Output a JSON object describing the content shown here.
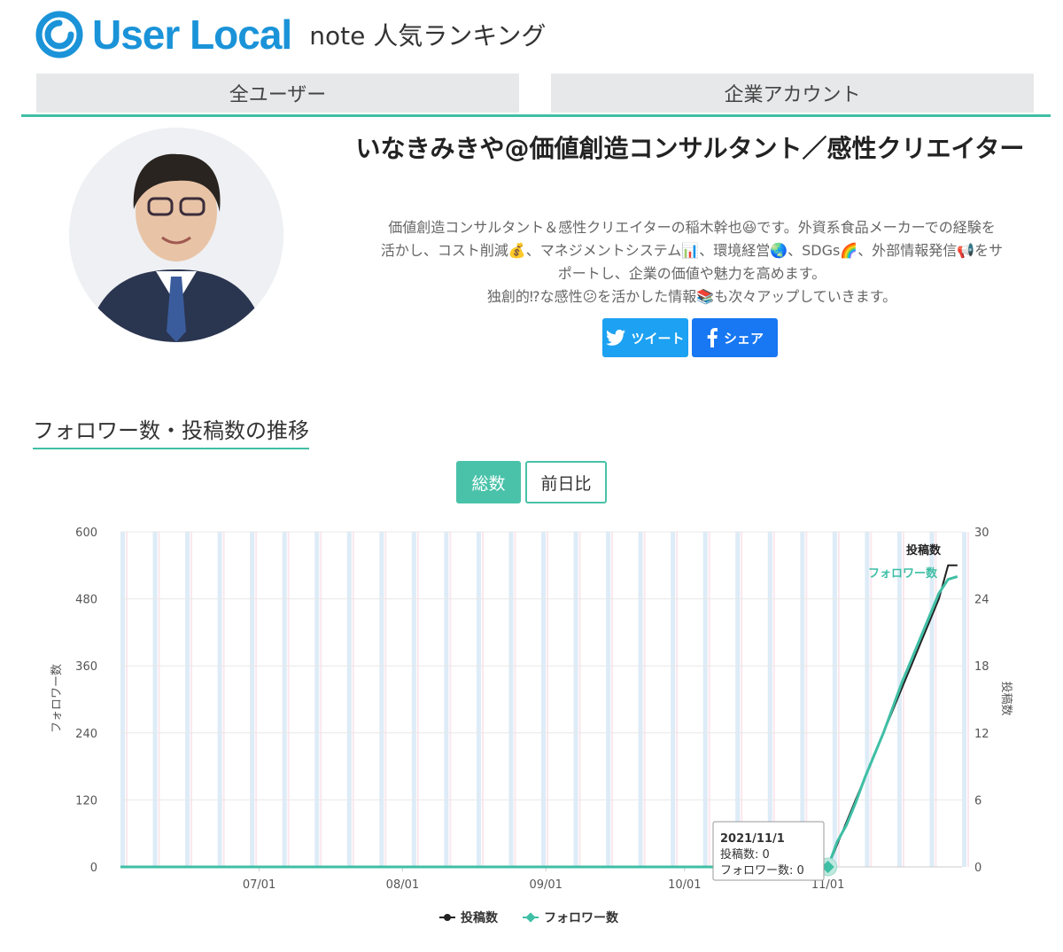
{
  "brand": {
    "name": "User Local",
    "site_title": "note 人気ランキング",
    "accent": "#1a93d8"
  },
  "tabs": [
    {
      "label": "全ユーザー"
    },
    {
      "label": "企業アカウント"
    }
  ],
  "profile": {
    "name": "いなきみきや@価値創造コンサルタント／感性クリエイター",
    "desc_lines": [
      "価値創造コンサルタント＆感性クリエイターの稲木幹也😆です。外資系食品メーカーでの経験を",
      "活かし、コスト削減💰、マネジメントシステム📊、環境経営🌏、SDGs🌈、外部情報発信📢をサ",
      "ポートし、企業の価値や魅力を高めます。",
      "独創的⁉な感性😕を活かした情報📚も次々アップしていきます。"
    ]
  },
  "share": {
    "tweet": "ツイート",
    "facebook": "シェア"
  },
  "section": {
    "title": "フォロワー数・投稿数の推移"
  },
  "toggle": {
    "total": "総数",
    "daily": "前日比"
  },
  "tooltip": {
    "date": "2021/11/1",
    "posts": "投稿数: 0",
    "followers": "フォロワー数: 0"
  },
  "colors": {
    "teal": "#3fbfa5",
    "posts_line": "#222222",
    "follower_line": "#3fbfa5"
  },
  "chart_data": {
    "type": "line",
    "x_ticks": [
      "07/01",
      "08/01",
      "09/01",
      "10/01",
      "11/01"
    ],
    "y_left": {
      "label": "フォロワー数",
      "ticks": [
        0,
        120,
        240,
        360,
        480,
        600
      ],
      "range": [
        0,
        600
      ]
    },
    "y_right": {
      "label": "投稿数",
      "ticks": [
        0,
        6,
        12,
        18,
        24,
        30
      ],
      "range": [
        0,
        30
      ]
    },
    "series": [
      {
        "name": "投稿数",
        "axis": "right",
        "color": "#222222",
        "points": [
          [
            "2021-06-01",
            0
          ],
          [
            "2021-11-01",
            0
          ],
          [
            "2021-11-03",
            2
          ],
          [
            "2021-11-05",
            4
          ],
          [
            "2021-11-07",
            6
          ],
          [
            "2021-11-09",
            8
          ],
          [
            "2021-11-11",
            10
          ],
          [
            "2021-11-13",
            12
          ],
          [
            "2021-11-15",
            14
          ],
          [
            "2021-11-17",
            16
          ],
          [
            "2021-11-19",
            18
          ],
          [
            "2021-11-21",
            20
          ],
          [
            "2021-11-23",
            22
          ],
          [
            "2021-11-25",
            24
          ],
          [
            "2021-11-27",
            27
          ],
          [
            "2021-11-29",
            27
          ]
        ]
      },
      {
        "name": "フォロワー数",
        "axis": "left",
        "color": "#3fbfa5",
        "points": [
          [
            "2021-06-01",
            0
          ],
          [
            "2021-11-01",
            0
          ],
          [
            "2021-11-03",
            45
          ],
          [
            "2021-11-05",
            75
          ],
          [
            "2021-11-07",
            115
          ],
          [
            "2021-11-09",
            160
          ],
          [
            "2021-11-11",
            200
          ],
          [
            "2021-11-13",
            240
          ],
          [
            "2021-11-15",
            285
          ],
          [
            "2021-11-17",
            330
          ],
          [
            "2021-11-19",
            370
          ],
          [
            "2021-11-21",
            410
          ],
          [
            "2021-11-23",
            450
          ],
          [
            "2021-11-25",
            490
          ],
          [
            "2021-11-27",
            515
          ],
          [
            "2021-11-29",
            520
          ]
        ]
      }
    ],
    "legend": {
      "position": "bottom",
      "items": [
        "投稿数",
        "フォロワー数"
      ]
    },
    "end_labels": [
      "投稿数",
      "フォロワー数"
    ],
    "grid": true
  }
}
